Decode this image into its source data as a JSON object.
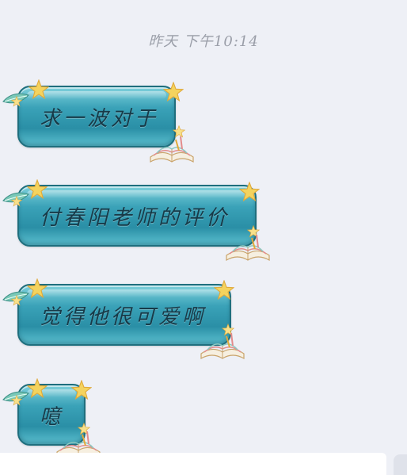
{
  "chat": {
    "timestamp": "昨天 下午10:14",
    "messages": [
      {
        "text": "求一波对于"
      },
      {
        "text": "付春阳老师的评价"
      },
      {
        "text": "觉得他很可爱啊"
      },
      {
        "text": "噫"
      }
    ]
  },
  "decorations": {
    "bubble_theme": "teal-glossy-star-book",
    "icons": [
      "star-icon",
      "leaf-icon",
      "book-icon"
    ],
    "colors": {
      "background": "#eef0f6",
      "bubble_top": "#7fd1dc",
      "bubble_mid": "#2a8fa6",
      "bubble_border": "#1f6f7e",
      "text": "#173a48",
      "timestamp": "#9a9ea8",
      "star": "#f4d35e"
    }
  }
}
